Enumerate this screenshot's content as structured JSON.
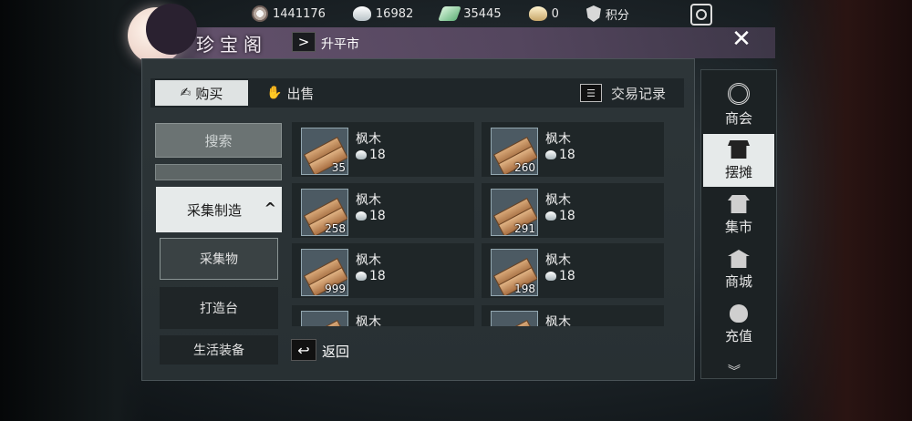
{
  "currencies": [
    {
      "icon": "tongbao-coin-icon",
      "value": "1441176"
    },
    {
      "icon": "silver-ingot-icon",
      "value": "16982"
    },
    {
      "icon": "jade-ticket-icon",
      "value": "35445"
    },
    {
      "icon": "gold-ingot-icon",
      "value": "0"
    }
  ],
  "points_label": "积分",
  "header": {
    "title": "珍宝阁",
    "breadcrumb": "升平市",
    "arrow": ">",
    "close": "✕"
  },
  "tabs": {
    "buy": "购买",
    "sell": "出售",
    "records": "交易记录"
  },
  "filters": {
    "search": "搜索",
    "category": "采集制造",
    "category_chevron": "^",
    "subitems": [
      "采集物",
      "打造台",
      "生活装备"
    ],
    "active_index": 0
  },
  "items": [
    {
      "name": "枫木",
      "price": "18",
      "qty": "35"
    },
    {
      "name": "枫木",
      "price": "18",
      "qty": "260"
    },
    {
      "name": "枫木",
      "price": "18",
      "qty": "258"
    },
    {
      "name": "枫木",
      "price": "18",
      "qty": "291"
    },
    {
      "name": "枫木",
      "price": "18",
      "qty": "999"
    },
    {
      "name": "枫木",
      "price": "18",
      "qty": "198"
    },
    {
      "name": "枫木",
      "price": "",
      "qty": ""
    },
    {
      "name": "枫木",
      "price": "",
      "qty": ""
    }
  ],
  "back_label": "返回",
  "right_nav": [
    {
      "label": "商会",
      "icon": "guild-icon"
    },
    {
      "label": "摆摊",
      "icon": "stall-icon",
      "active": true
    },
    {
      "label": "集市",
      "icon": "market-icon"
    },
    {
      "label": "商城",
      "icon": "shop-icon"
    },
    {
      "label": "充值",
      "icon": "recharge-icon"
    }
  ]
}
